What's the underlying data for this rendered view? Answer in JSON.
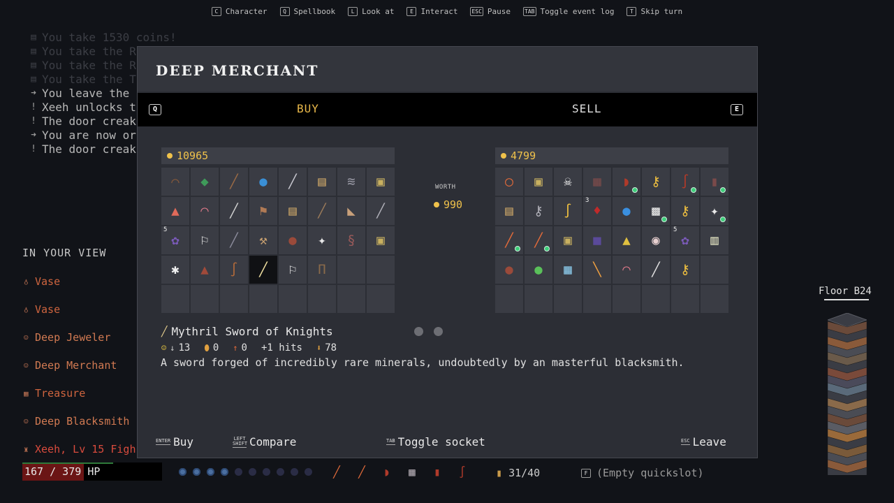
{
  "hints": [
    {
      "key": "C",
      "label": "Character"
    },
    {
      "key": "Q",
      "label": "Spellbook"
    },
    {
      "key": "L",
      "label": "Look at"
    },
    {
      "key": "E",
      "label": "Interact"
    },
    {
      "key": "ESC",
      "label": "Pause"
    },
    {
      "key": "TAB",
      "label": "Toggle event log"
    },
    {
      "key": "T",
      "label": "Skip turn"
    }
  ],
  "log": [
    {
      "icon": "chest-icon",
      "text": "You take 1530 coins!",
      "faded": true
    },
    {
      "icon": "chest-icon",
      "text": "You take the R",
      "faded": true
    },
    {
      "icon": "chest-icon",
      "text": "You take the R",
      "faded": true
    },
    {
      "icon": "chest-icon",
      "text": "You take the T",
      "faded": true
    },
    {
      "icon": "arrow-right-icon",
      "text": "You leave the ",
      "faded": false
    },
    {
      "icon": "exclamation-icon",
      "text": "Xeeh unlocks th",
      "faded": false
    },
    {
      "icon": "exclamation-icon",
      "text": "The door creak",
      "faded": false
    },
    {
      "icon": "arrow-right-icon",
      "text": "You are now or",
      "faded": false
    },
    {
      "icon": "exclamation-icon",
      "text": "The door creak",
      "faded": false
    }
  ],
  "view": {
    "title": "IN YOUR VIEW",
    "items": [
      {
        "icon": "vase-icon",
        "label": "Vase",
        "kind": "obj"
      },
      {
        "icon": "vase-icon",
        "label": "Vase",
        "kind": "obj"
      },
      {
        "icon": "npc-icon",
        "label": "Deep Jeweler",
        "kind": "npc"
      },
      {
        "icon": "npc-icon",
        "label": "Deep Merchant",
        "kind": "npc"
      },
      {
        "icon": "treasure-icon",
        "label": "Treasure",
        "kind": "obj"
      },
      {
        "icon": "npc-icon",
        "label": "Deep Blacksmith",
        "kind": "npc"
      },
      {
        "icon": "player-icon",
        "label": "Xeeh, Lv 15 Figh",
        "kind": "player"
      }
    ]
  },
  "floor": {
    "label": "Floor B24"
  },
  "hud": {
    "hp_text": "167 / 379",
    "hp_suffix": "HP",
    "hp_current": 167,
    "hp_max": 379,
    "mana_on": 4,
    "mana_total": 10,
    "inventory": "31/40",
    "quickslot": "(Empty quickslot)",
    "quickslot_key": "F",
    "quickbar": [
      "feather-icon",
      "feather-icon",
      "helmet-icon",
      "armor-icon",
      "boots-icon",
      "whip-icon"
    ]
  },
  "merchant": {
    "title": "DEEP MERCHANT",
    "tab_left_key": "Q",
    "tab_right_key": "E",
    "tab_buy": "BUY",
    "tab_sell": "SELL",
    "gold_left": "10965",
    "gold_right": "4799",
    "worth_label": "WORTH",
    "worth_value": "990",
    "shop_items": [
      {
        "icon": "bow-icon",
        "g": "⌒",
        "c": "#8a5a3a"
      },
      {
        "icon": "leaf-icon",
        "g": "◆",
        "c": "#3f9a5a"
      },
      {
        "icon": "staff-icon",
        "g": "╱",
        "c": "#9a6a45"
      },
      {
        "icon": "potion-blue-icon",
        "g": "●",
        "c": "#3a8fd6"
      },
      {
        "icon": "sword-icon",
        "g": "╱",
        "c": "#c8c8d0"
      },
      {
        "icon": "scroll-icon",
        "g": "▤",
        "c": "#c7a266"
      },
      {
        "icon": "claw-icon",
        "g": "≋",
        "c": "#9a9aa6"
      },
      {
        "icon": "scroll-green-icon",
        "g": "▣",
        "c": "#c8b060"
      },
      {
        "icon": "potion-red-icon",
        "g": "▲",
        "c": "#e06a5a"
      },
      {
        "icon": "ring-pink-icon",
        "g": "◠",
        "c": "#e07a8a"
      },
      {
        "icon": "dagger-icon",
        "g": "╱",
        "c": "#d0d0d0"
      },
      {
        "icon": "axe-icon",
        "g": "⚑",
        "c": "#b07a55"
      },
      {
        "icon": "scroll-icon",
        "g": "▤",
        "c": "#c7a266"
      },
      {
        "icon": "spear-icon",
        "g": "╱",
        "c": "#9a7a5a"
      },
      {
        "icon": "hat-icon",
        "g": "◣",
        "c": "#c8a07a"
      },
      {
        "icon": "knife-icon",
        "g": "╱",
        "c": "#b0b0b8"
      },
      {
        "icon": "grapes-icon",
        "g": "✿",
        "c": "#7a5ab8",
        "count": "5"
      },
      {
        "icon": "flag-icon",
        "g": "⚐",
        "c": "#e8e8e8"
      },
      {
        "icon": "dagger-icon",
        "g": "╱",
        "c": "#8a8a9a"
      },
      {
        "icon": "pickaxe-icon",
        "g": "⚒",
        "c": "#c8a070"
      },
      {
        "icon": "glove-icon",
        "g": "●",
        "c": "#9a4a3a"
      },
      {
        "icon": "bone-icon",
        "g": "✦",
        "c": "#e8e8e8"
      },
      {
        "icon": "tentacle-icon",
        "g": "§",
        "c": "#9a5a5a"
      },
      {
        "icon": "scroll-icon",
        "g": "▣",
        "c": "#c8b060"
      },
      {
        "icon": "ribcage-icon",
        "g": "✱",
        "c": "#f0f0f0"
      },
      {
        "icon": "poop-icon",
        "g": "▲",
        "c": "#a04a3a"
      },
      {
        "icon": "whip-icon",
        "g": "∫",
        "c": "#b06a3a"
      },
      {
        "icon": "mythril-sword-icon",
        "g": "╱",
        "c": "#f0e0a0",
        "selected": true
      },
      {
        "icon": "flag-icon",
        "g": "⚐",
        "c": "#e8e8e8"
      },
      {
        "icon": "pants-icon",
        "g": "Π",
        "c": "#8a6a4a"
      },
      {
        "icon": "",
        "g": "",
        "c": ""
      },
      {
        "icon": "",
        "g": "",
        "c": ""
      },
      {
        "icon": "",
        "g": "",
        "c": ""
      },
      {
        "icon": "",
        "g": "",
        "c": ""
      },
      {
        "icon": "",
        "g": "",
        "c": ""
      },
      {
        "icon": "",
        "g": "",
        "c": ""
      },
      {
        "icon": "",
        "g": "",
        "c": ""
      },
      {
        "icon": "",
        "g": "",
        "c": ""
      },
      {
        "icon": "",
        "g": "",
        "c": ""
      },
      {
        "icon": "",
        "g": "",
        "c": ""
      }
    ],
    "player_items": [
      {
        "icon": "ring-icon",
        "g": "◯",
        "c": "#e06a3a"
      },
      {
        "icon": "scroll-icon",
        "g": "▣",
        "c": "#c8b060"
      },
      {
        "icon": "skull-icon",
        "g": "☠",
        "c": "#f0f0f0"
      },
      {
        "icon": "armor-icon",
        "g": "▦",
        "c": "#7a4a4a"
      },
      {
        "icon": "helmet-icon",
        "g": "◗",
        "c": "#b03a2a",
        "gem": true
      },
      {
        "icon": "key-icon",
        "g": "⚷",
        "c": "#f0c040"
      },
      {
        "icon": "whip-icon",
        "g": "∫",
        "c": "#b03a2a",
        "gem": true
      },
      {
        "icon": "boots-icon",
        "g": "▮",
        "c": "#7a4a4a",
        "gem": true
      },
      {
        "icon": "scroll-icon",
        "g": "▤",
        "c": "#c7a266"
      },
      {
        "icon": "key-icon",
        "g": "⚷",
        "c": "#b0b0b8"
      },
      {
        "icon": "whip-icon",
        "g": "∫",
        "c": "#f0c040"
      },
      {
        "icon": "meat-icon",
        "g": "♦",
        "c": "#c02a2a",
        "count": "3"
      },
      {
        "icon": "orb-icon",
        "g": "●",
        "c": "#3a8fe0"
      },
      {
        "icon": "mask-icon",
        "g": "▩",
        "c": "#e8e8e8",
        "gem": true
      },
      {
        "icon": "key-icon",
        "g": "⚷",
        "c": "#f0c040"
      },
      {
        "icon": "bone-icon",
        "g": "✦",
        "c": "#e8e8e8",
        "gem": true
      },
      {
        "icon": "feather-icon",
        "g": "╱",
        "c": "#e06a3a",
        "gem": true
      },
      {
        "icon": "feather-icon",
        "g": "╱",
        "c": "#e06a3a",
        "gem": true
      },
      {
        "icon": "scroll-icon",
        "g": "▣",
        "c": "#c8b060"
      },
      {
        "icon": "cube-icon",
        "g": "■",
        "c": "#5a4a9a"
      },
      {
        "icon": "slime-icon",
        "g": "▲",
        "c": "#e0c040"
      },
      {
        "icon": "eye-icon",
        "g": "◉",
        "c": "#e8d0d0"
      },
      {
        "icon": "grapes-icon",
        "g": "✿",
        "c": "#7a5ab8",
        "count": "5"
      },
      {
        "icon": "ribs-icon",
        "g": "▥",
        "c": "#e0e0c0"
      },
      {
        "icon": "glove-icon",
        "g": "●",
        "c": "#9a4a3a"
      },
      {
        "icon": "clover-icon",
        "g": "●",
        "c": "#5ac05a"
      },
      {
        "icon": "ice-icon",
        "g": "▦",
        "c": "#8ac8e8"
      },
      {
        "icon": "feather-gold-icon",
        "g": "╲",
        "c": "#f0a040"
      },
      {
        "icon": "ring-pink-icon",
        "g": "◠",
        "c": "#e07a8a"
      },
      {
        "icon": "knife-icon",
        "g": "╱",
        "c": "#e0e0e0"
      },
      {
        "icon": "key-icon",
        "g": "⚷",
        "c": "#f0c040"
      },
      {
        "icon": "",
        "g": "",
        "c": ""
      },
      {
        "icon": "",
        "g": "",
        "c": ""
      },
      {
        "icon": "",
        "g": "",
        "c": ""
      },
      {
        "icon": "",
        "g": "",
        "c": ""
      },
      {
        "icon": "",
        "g": "",
        "c": ""
      },
      {
        "icon": "",
        "g": "",
        "c": ""
      },
      {
        "icon": "",
        "g": "",
        "c": ""
      },
      {
        "icon": "",
        "g": "",
        "c": ""
      },
      {
        "icon": "",
        "g": "",
        "c": ""
      }
    ],
    "selected": {
      "name": "Mythril Sword of Knights",
      "stats": [
        {
          "icon": "attack-icon",
          "text": "13"
        },
        {
          "icon": "defense-icon",
          "text": "0"
        },
        {
          "icon": "dodge-icon",
          "text": "0"
        },
        {
          "icon": "",
          "text": "+1 hits"
        },
        {
          "icon": "weight-icon",
          "text": "78"
        }
      ],
      "description": "A sword forged of incredibly rare minerals, undoubtedly by an masterful blacksmith."
    },
    "actions": {
      "buy_key": "ENTER",
      "buy": "Buy",
      "compare_key": "LEFT SHIFT",
      "compare": "Compare",
      "socket_key": "TAB",
      "socket": "Toggle socket",
      "leave_key": "ESC",
      "leave": "Leave"
    }
  }
}
